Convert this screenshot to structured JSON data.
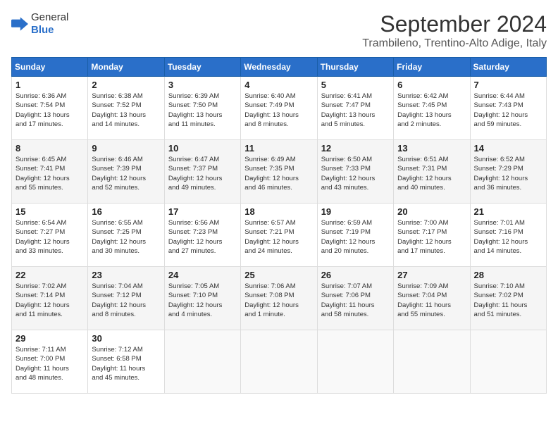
{
  "header": {
    "logo_general": "General",
    "logo_blue": "Blue",
    "month_title": "September 2024",
    "location": "Trambileno, Trentino-Alto Adige, Italy"
  },
  "weekdays": [
    "Sunday",
    "Monday",
    "Tuesday",
    "Wednesday",
    "Thursday",
    "Friday",
    "Saturday"
  ],
  "weeks": [
    [
      {
        "day": "1",
        "info": "Sunrise: 6:36 AM\nSunset: 7:54 PM\nDaylight: 13 hours\nand 17 minutes."
      },
      {
        "day": "2",
        "info": "Sunrise: 6:38 AM\nSunset: 7:52 PM\nDaylight: 13 hours\nand 14 minutes."
      },
      {
        "day": "3",
        "info": "Sunrise: 6:39 AM\nSunset: 7:50 PM\nDaylight: 13 hours\nand 11 minutes."
      },
      {
        "day": "4",
        "info": "Sunrise: 6:40 AM\nSunset: 7:49 PM\nDaylight: 13 hours\nand 8 minutes."
      },
      {
        "day": "5",
        "info": "Sunrise: 6:41 AM\nSunset: 7:47 PM\nDaylight: 13 hours\nand 5 minutes."
      },
      {
        "day": "6",
        "info": "Sunrise: 6:42 AM\nSunset: 7:45 PM\nDaylight: 13 hours\nand 2 minutes."
      },
      {
        "day": "7",
        "info": "Sunrise: 6:44 AM\nSunset: 7:43 PM\nDaylight: 12 hours\nand 59 minutes."
      }
    ],
    [
      {
        "day": "8",
        "info": "Sunrise: 6:45 AM\nSunset: 7:41 PM\nDaylight: 12 hours\nand 55 minutes."
      },
      {
        "day": "9",
        "info": "Sunrise: 6:46 AM\nSunset: 7:39 PM\nDaylight: 12 hours\nand 52 minutes."
      },
      {
        "day": "10",
        "info": "Sunrise: 6:47 AM\nSunset: 7:37 PM\nDaylight: 12 hours\nand 49 minutes."
      },
      {
        "day": "11",
        "info": "Sunrise: 6:49 AM\nSunset: 7:35 PM\nDaylight: 12 hours\nand 46 minutes."
      },
      {
        "day": "12",
        "info": "Sunrise: 6:50 AM\nSunset: 7:33 PM\nDaylight: 12 hours\nand 43 minutes."
      },
      {
        "day": "13",
        "info": "Sunrise: 6:51 AM\nSunset: 7:31 PM\nDaylight: 12 hours\nand 40 minutes."
      },
      {
        "day": "14",
        "info": "Sunrise: 6:52 AM\nSunset: 7:29 PM\nDaylight: 12 hours\nand 36 minutes."
      }
    ],
    [
      {
        "day": "15",
        "info": "Sunrise: 6:54 AM\nSunset: 7:27 PM\nDaylight: 12 hours\nand 33 minutes."
      },
      {
        "day": "16",
        "info": "Sunrise: 6:55 AM\nSunset: 7:25 PM\nDaylight: 12 hours\nand 30 minutes."
      },
      {
        "day": "17",
        "info": "Sunrise: 6:56 AM\nSunset: 7:23 PM\nDaylight: 12 hours\nand 27 minutes."
      },
      {
        "day": "18",
        "info": "Sunrise: 6:57 AM\nSunset: 7:21 PM\nDaylight: 12 hours\nand 24 minutes."
      },
      {
        "day": "19",
        "info": "Sunrise: 6:59 AM\nSunset: 7:19 PM\nDaylight: 12 hours\nand 20 minutes."
      },
      {
        "day": "20",
        "info": "Sunrise: 7:00 AM\nSunset: 7:17 PM\nDaylight: 12 hours\nand 17 minutes."
      },
      {
        "day": "21",
        "info": "Sunrise: 7:01 AM\nSunset: 7:16 PM\nDaylight: 12 hours\nand 14 minutes."
      }
    ],
    [
      {
        "day": "22",
        "info": "Sunrise: 7:02 AM\nSunset: 7:14 PM\nDaylight: 12 hours\nand 11 minutes."
      },
      {
        "day": "23",
        "info": "Sunrise: 7:04 AM\nSunset: 7:12 PM\nDaylight: 12 hours\nand 8 minutes."
      },
      {
        "day": "24",
        "info": "Sunrise: 7:05 AM\nSunset: 7:10 PM\nDaylight: 12 hours\nand 4 minutes."
      },
      {
        "day": "25",
        "info": "Sunrise: 7:06 AM\nSunset: 7:08 PM\nDaylight: 12 hours\nand 1 minute."
      },
      {
        "day": "26",
        "info": "Sunrise: 7:07 AM\nSunset: 7:06 PM\nDaylight: 11 hours\nand 58 minutes."
      },
      {
        "day": "27",
        "info": "Sunrise: 7:09 AM\nSunset: 7:04 PM\nDaylight: 11 hours\nand 55 minutes."
      },
      {
        "day": "28",
        "info": "Sunrise: 7:10 AM\nSunset: 7:02 PM\nDaylight: 11 hours\nand 51 minutes."
      }
    ],
    [
      {
        "day": "29",
        "info": "Sunrise: 7:11 AM\nSunset: 7:00 PM\nDaylight: 11 hours\nand 48 minutes."
      },
      {
        "day": "30",
        "info": "Sunrise: 7:12 AM\nSunset: 6:58 PM\nDaylight: 11 hours\nand 45 minutes."
      },
      {
        "day": "",
        "info": ""
      },
      {
        "day": "",
        "info": ""
      },
      {
        "day": "",
        "info": ""
      },
      {
        "day": "",
        "info": ""
      },
      {
        "day": "",
        "info": ""
      }
    ]
  ]
}
